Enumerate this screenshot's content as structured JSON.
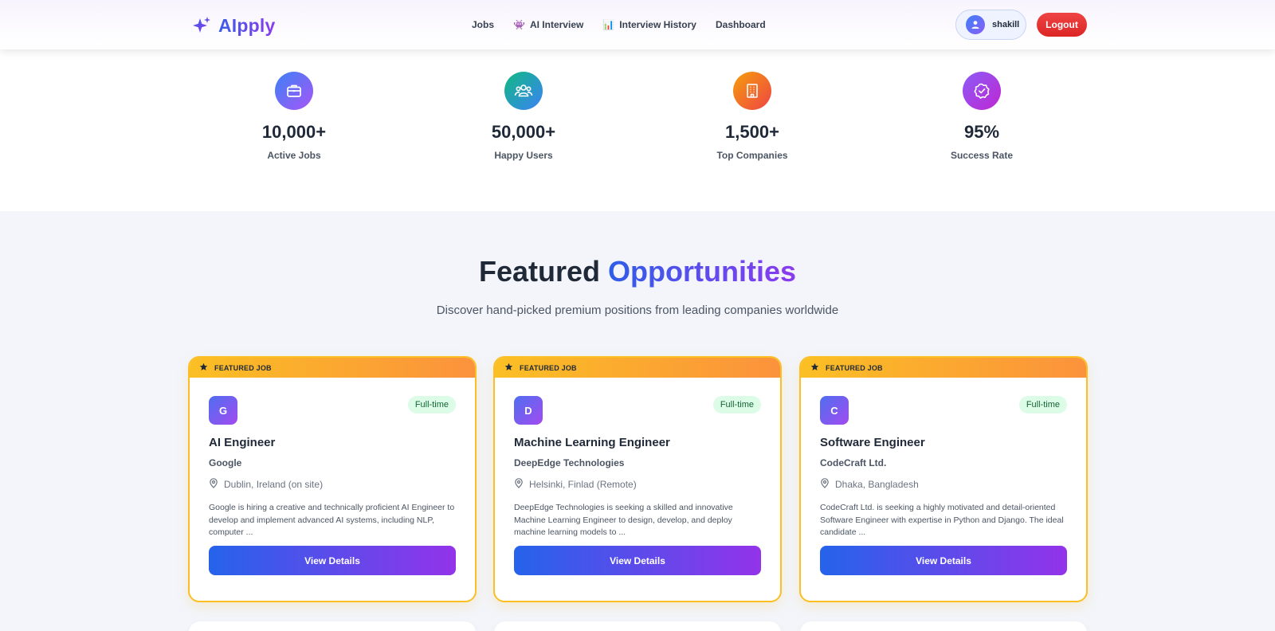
{
  "header": {
    "logo_text": "AIpply",
    "nav": [
      {
        "label": "Jobs",
        "icon": ""
      },
      {
        "label": "AI Interview",
        "icon": "👾"
      },
      {
        "label": "Interview History",
        "icon": "📊"
      },
      {
        "label": "Dashboard",
        "icon": ""
      }
    ],
    "user": {
      "name": "shakill"
    },
    "logout_label": "Logout"
  },
  "stats": [
    {
      "value": "10,000+",
      "label": "Active Jobs",
      "icon": "briefcase-icon",
      "gradient": [
        "#3b82f6",
        "#a855f7"
      ]
    },
    {
      "value": "50,000+",
      "label": "Happy Users",
      "icon": "users-icon",
      "gradient": [
        "#10b981",
        "#3b82f6"
      ]
    },
    {
      "value": "1,500+",
      "label": "Top Companies",
      "icon": "building-icon",
      "gradient": [
        "#f59e0b",
        "#ef4444"
      ]
    },
    {
      "value": "95%",
      "label": "Success Rate",
      "icon": "badge-check-icon",
      "gradient": [
        "#8b5cf6",
        "#c026d3"
      ]
    }
  ],
  "featured": {
    "title_part1": "Featured",
    "title_part2": "Opportunities",
    "subtitle": "Discover hand-picked premium positions from leading companies worldwide",
    "cards": [
      {
        "banner": "FEATURED JOB",
        "initial": "G",
        "type": "Full-time",
        "title": "AI Engineer",
        "company": "Google",
        "location": "Dublin, Ireland (on site)",
        "description": "Google is hiring a creative and technically proficient AI Engineer to develop and implement advanced AI systems, including NLP, computer ...",
        "button": "View Details"
      },
      {
        "banner": "FEATURED JOB",
        "initial": "D",
        "type": "Full-time",
        "title": "Machine Learning Engineer",
        "company": "DeepEdge Technologies",
        "location": "Helsinki, Finlad (Remote)",
        "description": "DeepEdge Technologies is seeking a skilled and innovative Machine Learning Engineer to design, develop, and deploy machine learning models to ...",
        "button": "View Details"
      },
      {
        "banner": "FEATURED JOB",
        "initial": "C",
        "type": "Full-time",
        "title": "Software Engineer",
        "company": "CodeCraft Ltd.",
        "location": "Dhaka, Bangladesh",
        "description": "CodeCraft Ltd. is seeking a highly motivated and detail-oriented Software Engineer with expertise in Python and Django. The ideal candidate ...",
        "button": "View Details"
      }
    ]
  },
  "colors": {
    "accent_blue": "#2563eb",
    "accent_purple": "#9333ea",
    "featured_border": "#fbbf24",
    "logout_red": "#ef4444"
  }
}
